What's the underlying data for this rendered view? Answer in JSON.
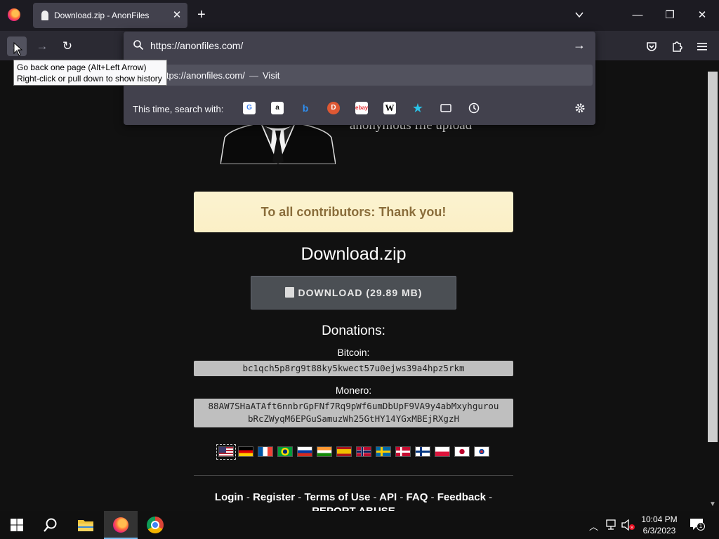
{
  "browser": {
    "tab": {
      "title": "Download.zip - AnonFiles",
      "close": "✕"
    },
    "new_tab": "+",
    "window_controls": {
      "minimize": "—",
      "restore": "❐",
      "close": "✕"
    },
    "nav": {
      "back": "←",
      "forward": "→",
      "reload": "↻"
    }
  },
  "urlbar": {
    "value": "https://anonfiles.com/",
    "go": "→",
    "suggestion": {
      "url": "https://anonfiles.com/",
      "separator": "—",
      "action": "Visit"
    },
    "search_with_label": "This time, search with:",
    "engines": [
      "google-icon",
      "amazon-icon",
      "bing-icon",
      "duckduckgo-icon",
      "ebay-icon",
      "wikipedia-icon",
      "bookmarks-star-icon",
      "tabs-icon",
      "history-icon"
    ]
  },
  "tooltip": {
    "line1": "Go back one page (Alt+Left Arrow)",
    "line2": "Right-click or pull down to show history"
  },
  "page": {
    "slogan": "anonymous file upload",
    "thanks_banner": "To all contributors: Thank you!",
    "file_name": "Download.zip",
    "download_label": "DOWNLOAD (29.89 MB)",
    "donations_title": "Donations:",
    "bitcoin_label": "Bitcoin:",
    "bitcoin_address": "bc1qch5p8rg9t88ky5kwect57u0ejws39a4hpz5rkm",
    "monero_label": "Monero:",
    "monero_address_line1": "88AW7SHaATAft6nnbrGpFNf7Rq9pWf6umDbUpF9VA9y4abMxyhgurou",
    "monero_address_line2": "bRcZWyqM6EPGuSamuzWh25GtHY14YGxMBEjRXgzH",
    "flags": [
      "us",
      "de",
      "fr",
      "br",
      "ru",
      "in",
      "es",
      "no",
      "se",
      "dk",
      "fi",
      "pl",
      "jp",
      "kr"
    ],
    "footer": {
      "login": "Login",
      "register": "Register",
      "terms": "Terms of Use",
      "api": "API",
      "faq": "FAQ",
      "feedback": "Feedback",
      "report_abuse": "REPORT ABUSE",
      "separator": "-"
    }
  },
  "taskbar": {
    "time": "10:04 PM",
    "date": "6/3/2023",
    "notification_count": "1"
  }
}
